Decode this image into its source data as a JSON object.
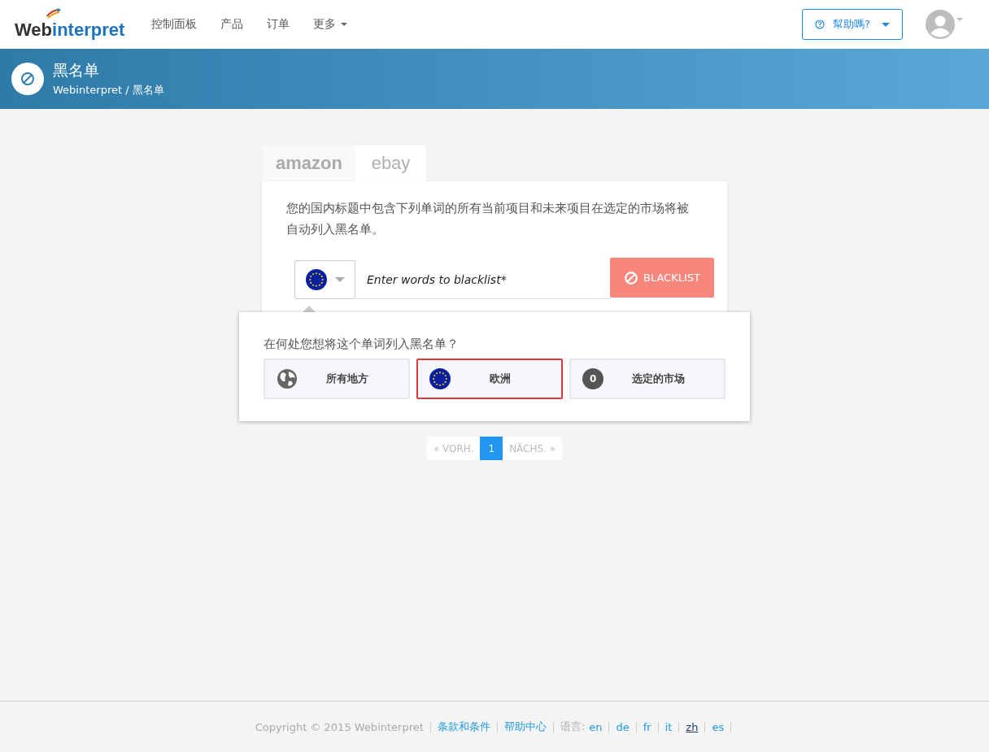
{
  "nav": {
    "logo": {
      "part1": "Web",
      "part2": "interpret"
    },
    "links": [
      {
        "label": "控制面板",
        "dropdown": false
      },
      {
        "label": "产品",
        "dropdown": false
      },
      {
        "label": "订单",
        "dropdown": false
      },
      {
        "label": "更多",
        "dropdown": true
      }
    ],
    "help_button": "幫助嗎?"
  },
  "banner": {
    "title": "黑名单",
    "breadcrumb": "Webinterpret / 黑名单"
  },
  "tabs": [
    {
      "label": "amazon",
      "selected": false
    },
    {
      "label": "ebay",
      "selected": true
    }
  ],
  "description": "您的国内标题中包含下列单词的所有当前项目和未来项目在选定的市场将被自动列入黑名单。",
  "input": {
    "placeholder": "Enter words to blacklist*"
  },
  "blacklist_button": "BLACKLIST",
  "popup": {
    "question": "在何处您想将这个单词列入黑名单？",
    "options": [
      {
        "kind": "globe",
        "label": "所有地方",
        "selected": false
      },
      {
        "kind": "flag",
        "label": "欧洲",
        "selected": true
      },
      {
        "kind": "count",
        "count": "0",
        "label": "选定的市场",
        "selected": false
      }
    ]
  },
  "pagination": [
    {
      "label": "« VORH.",
      "selected": false,
      "disabled": true
    },
    {
      "label": "1",
      "selected": true,
      "disabled": false
    },
    {
      "label": "NÄCHS. »",
      "selected": false,
      "disabled": true
    }
  ],
  "footer": {
    "copyright": "Copyright © 2015 Webinterpret",
    "links": [
      "条款和条件",
      "帮助中心"
    ],
    "language_label": "语言:",
    "languages": [
      {
        "code": "en",
        "selected": false
      },
      {
        "code": "de",
        "selected": false
      },
      {
        "code": "fr",
        "selected": false
      },
      {
        "code": "it",
        "selected": false
      },
      {
        "code": "zh",
        "selected": true
      },
      {
        "code": "es",
        "selected": false
      }
    ]
  }
}
